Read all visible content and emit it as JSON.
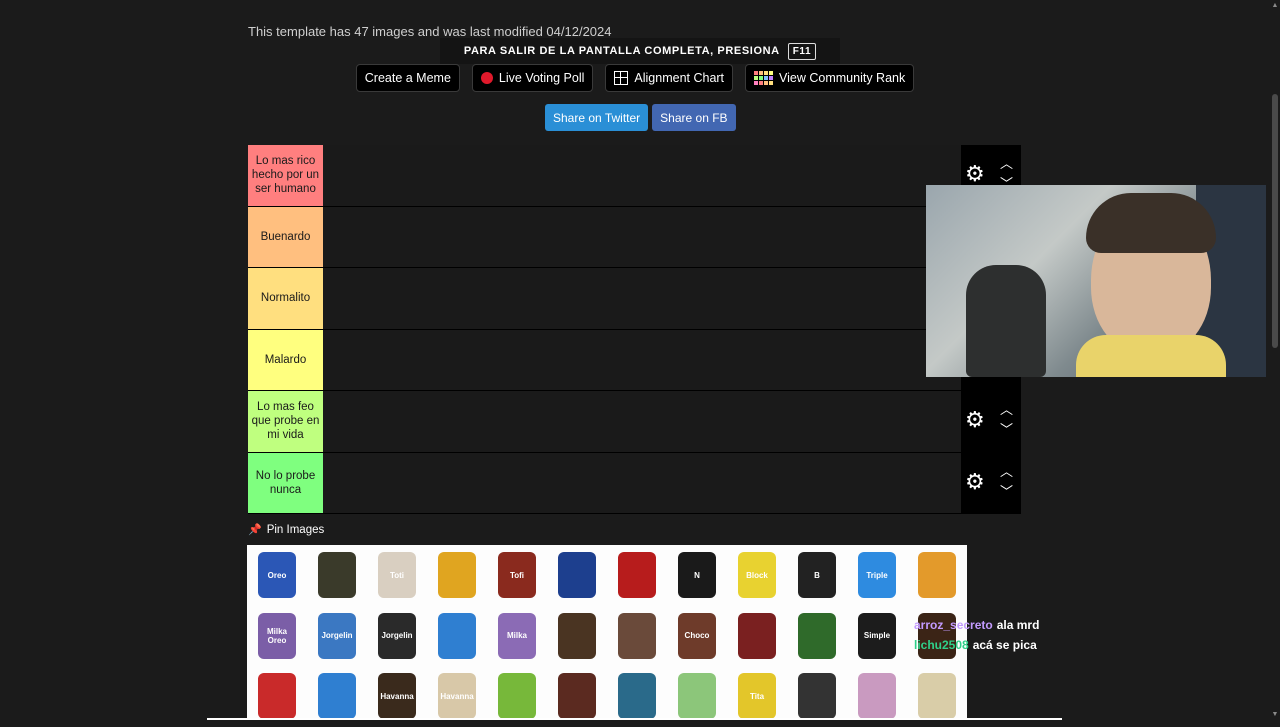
{
  "header": {
    "info_text": "This template has 47 images and was last modified 04/12/2024",
    "fullscreen_notice": "Para salir de la pantalla completa, presiona",
    "fullscreen_key": "F11"
  },
  "toolbar": {
    "create_meme": "Create a Meme",
    "live_voting_poll": "Live Voting Poll",
    "alignment_chart": "Alignment Chart",
    "view_community_rank": "View Community Rank"
  },
  "share": {
    "twitter": "Share on Twitter",
    "facebook": "Share on FB",
    "twitter_color": "#2a8fd6",
    "facebook_color": "#4267b2"
  },
  "tiers": [
    {
      "label": "Lo mas rico hecho por un ser humano",
      "color": "#ff7f7f"
    },
    {
      "label": "Buenardo",
      "color": "#ffbf7f"
    },
    {
      "label": "Normalito",
      "color": "#ffdf7f"
    },
    {
      "label": "Malardo",
      "color": "#ffff7f"
    },
    {
      "label": "Lo mas feo que probe en mi vida",
      "color": "#bfff7f"
    },
    {
      "label": "No lo probe nunca",
      "color": "#7fff7f"
    }
  ],
  "icons": {
    "gear": "gear-icon",
    "up": "chevron-up-icon",
    "down": "chevron-down-icon",
    "pin": "pin-icon"
  },
  "pin_images_label": "Pin Images",
  "image_pool": [
    {
      "text": "Oreo",
      "color": "#2b57b6"
    },
    {
      "text": "",
      "color": "#3a3a2a"
    },
    {
      "text": "Toti",
      "color": "#d9cfc1"
    },
    {
      "text": "",
      "color": "#e0a520"
    },
    {
      "text": "Tofi",
      "color": "#8a2a1e"
    },
    {
      "text": "",
      "color": "#1d3f8e"
    },
    {
      "text": "",
      "color": "#b71c1c"
    },
    {
      "text": "N",
      "color": "#1a1a1a"
    },
    {
      "text": "Block",
      "color": "#e8d230"
    },
    {
      "text": "B",
      "color": "#222"
    },
    {
      "text": "Triple",
      "color": "#2e8be0"
    },
    {
      "text": "",
      "color": "#e39a2b"
    },
    {
      "text": "Milka Oreo",
      "color": "#7b5ea7"
    },
    {
      "text": "Jorgelin",
      "color": "#3b78c2"
    },
    {
      "text": "Jorgelin",
      "color": "#2a2a2a"
    },
    {
      "text": "",
      "color": "#2f7fd1"
    },
    {
      "text": "Milka",
      "color": "#8b6bb5"
    },
    {
      "text": "",
      "color": "#4a3422"
    },
    {
      "text": "",
      "color": "#6a4a3a"
    },
    {
      "text": "Choco",
      "color": "#6e3b2a"
    },
    {
      "text": "",
      "color": "#7a2020"
    },
    {
      "text": "",
      "color": "#2f6a2a"
    },
    {
      "text": "Simple",
      "color": "#1c1c1c"
    },
    {
      "text": "",
      "color": "#3b2416"
    },
    {
      "text": "",
      "color": "#c92a2a"
    },
    {
      "text": "",
      "color": "#2f7fd1"
    },
    {
      "text": "Havanna",
      "color": "#3a2a1c"
    },
    {
      "text": "Havanna",
      "color": "#d8c8a8"
    },
    {
      "text": "",
      "color": "#77b83a"
    },
    {
      "text": "",
      "color": "#5b2a20"
    },
    {
      "text": "",
      "color": "#2a6a8a"
    },
    {
      "text": "",
      "color": "#8cc67a"
    },
    {
      "text": "Tita",
      "color": "#e3c62a"
    },
    {
      "text": "",
      "color": "#333"
    },
    {
      "text": "",
      "color": "#c99ac0"
    },
    {
      "text": "",
      "color": "#d9cda8"
    }
  ],
  "chat": [
    {
      "user": "arroz_secreto",
      "message": "ala mrd"
    },
    {
      "user": "lichu2508",
      "message": "acá se pica"
    }
  ]
}
